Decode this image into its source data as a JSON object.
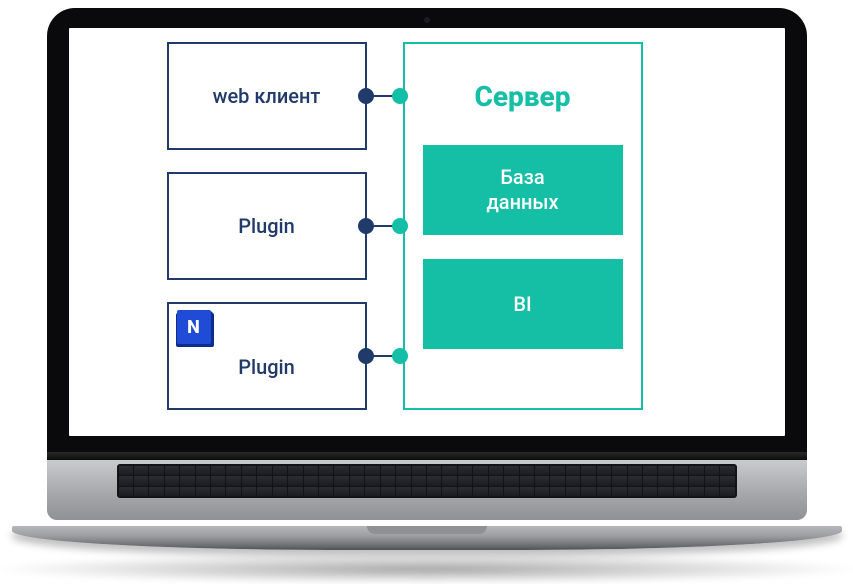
{
  "diagram": {
    "clients": [
      {
        "label": "web клиент",
        "icon": null
      },
      {
        "label": "Plugin",
        "icon": null
      },
      {
        "label": "Plugin",
        "icon": "N"
      }
    ],
    "server": {
      "title": "Сервер",
      "components": [
        {
          "label": "База\nданных"
        },
        {
          "label": "BI"
        }
      ]
    }
  }
}
